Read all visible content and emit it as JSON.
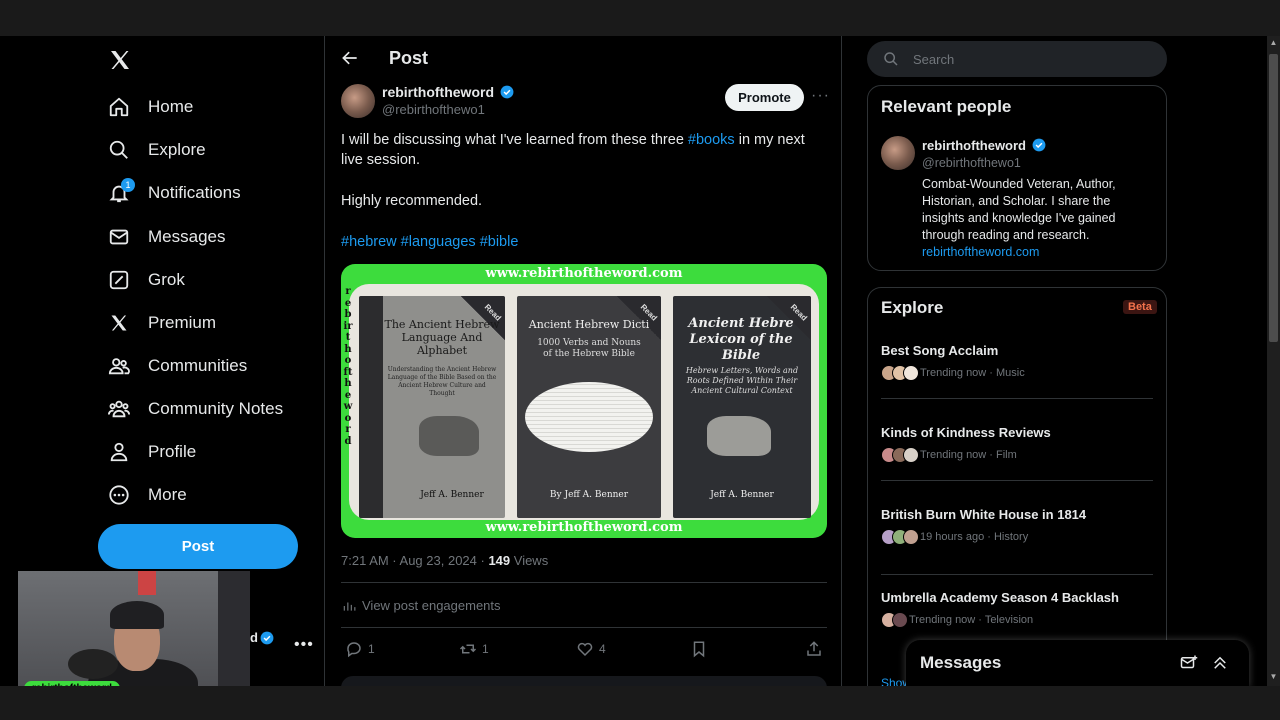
{
  "nav": {
    "items": [
      {
        "label": "Home",
        "icon": "home-icon"
      },
      {
        "label": "Explore",
        "icon": "search-icon"
      },
      {
        "label": "Notifications",
        "icon": "bell-icon",
        "badge": "1"
      },
      {
        "label": "Messages",
        "icon": "envelope-icon"
      },
      {
        "label": "Grok",
        "icon": "grok-icon"
      },
      {
        "label": "Premium",
        "icon": "x-logo-icon"
      },
      {
        "label": "Communities",
        "icon": "people-icon"
      },
      {
        "label": "Community Notes",
        "icon": "community-notes-icon"
      },
      {
        "label": "Profile",
        "icon": "person-icon"
      },
      {
        "label": "More",
        "icon": "more-circle-icon"
      }
    ],
    "post_button": "Post"
  },
  "webcam": {
    "tag": "rebirthoftheword",
    "name_suffix": "d"
  },
  "header": {
    "title": "Post"
  },
  "tweet": {
    "author_name": "rebirthoftheword",
    "author_handle": "@rebirthofthewo1",
    "promote_label": "Promote",
    "text_before": "I will be discussing what I've learned from these three ",
    "hashtag_books": "#books",
    "text_after": " in my next live session.",
    "line2": "Highly recommended.",
    "hashtags": [
      "#hebrew",
      "#languages",
      "#bible"
    ],
    "media": {
      "url_top": "www.rebirthoftheword.com",
      "url_bottom": "www.rebirthoftheword.com",
      "side_text": "rebirthoftheword",
      "books": [
        {
          "title": "The Ancient Hebrew Language And Alphabet",
          "subtitle": "Understanding the Ancient Hebrew Language of the Bible Based on the Ancient Hebrew Culture and Thought",
          "author": "Jeff A. Benner",
          "badge": "Read"
        },
        {
          "title": "Ancient Hebrew Dicti",
          "subtitle": "1000 Verbs and Nouns of the Hebrew Bible",
          "author": "By Jeff A. Benner",
          "badge": "Read"
        },
        {
          "title": "Ancient Hebre Lexicon of the Bible",
          "subtitle": "Hebrew Letters, Words and Roots Defined Within Their Ancient Cultural Context",
          "author": "Jeff A. Benner",
          "badge": "Read"
        }
      ]
    },
    "time": "7:21 AM · Aug 23, 2024 · ",
    "views_count": "149",
    "views_label": " Views",
    "engagements_label": "View post engagements",
    "actions": {
      "replies": "1",
      "reposts": "1",
      "likes": "4"
    }
  },
  "search": {
    "placeholder": "Search"
  },
  "relevant_people": {
    "title": "Relevant people",
    "name": "rebirthoftheword",
    "handle": "@rebirthofthewo1",
    "bio": "Combat-Wounded Veteran, Author, Historian, and Scholar. I share the insights and knowledge I've gained through reading and research.",
    "link": "rebirthoftheword.com"
  },
  "explore": {
    "title": "Explore",
    "beta": "Beta",
    "trends": [
      {
        "title": "Best Song Acclaim",
        "meta": "Trending now · Music"
      },
      {
        "title": "Kinds of Kindness Reviews",
        "meta": "Trending now · Film"
      },
      {
        "title": "British Burn White House in 1814",
        "meta": "19 hours ago · History"
      },
      {
        "title": "Umbrella Academy Season 4 Backlash",
        "meta": "Trending now · Television"
      }
    ],
    "show_more": "Show"
  },
  "messages_drawer": {
    "title": "Messages"
  },
  "colors": {
    "accent": "#1d9bf0",
    "media_border": "#3ddc3d",
    "background": "#000000"
  }
}
